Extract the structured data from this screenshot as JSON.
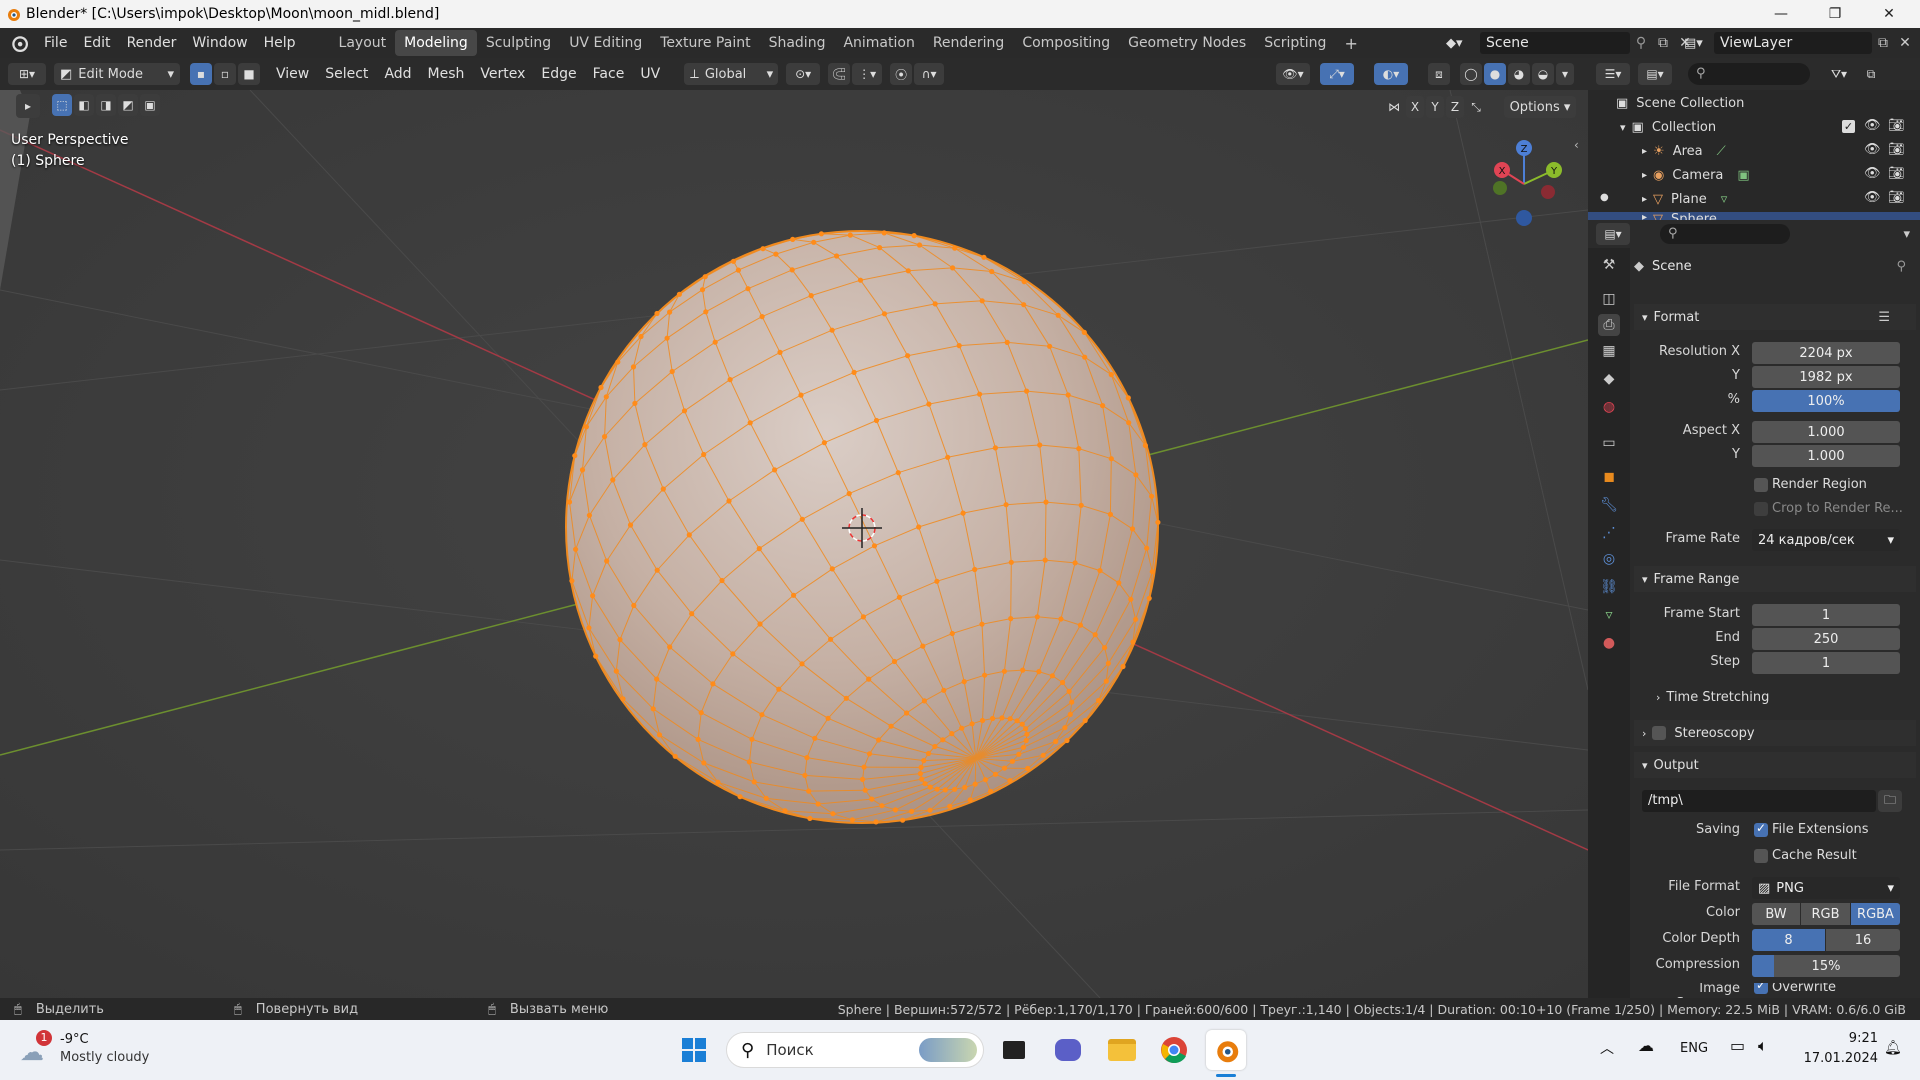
{
  "window": {
    "title": "Blender* [C:\\Users\\impok\\Desktop\\Moon\\moon_midl.blend]"
  },
  "menu": [
    "File",
    "Edit",
    "Render",
    "Window",
    "Help"
  ],
  "workspaces": [
    "Layout",
    "Modeling",
    "Sculpting",
    "UV Editing",
    "Texture Paint",
    "Shading",
    "Animation",
    "Rendering",
    "Compositing",
    "Geometry Nodes",
    "Scripting"
  ],
  "active_workspace": "Modeling",
  "scene_name": "Scene",
  "view_layer": "ViewLayer",
  "viewport_header": {
    "mode": "Edit Mode",
    "menus": [
      "View",
      "Select",
      "Add",
      "Mesh",
      "Vertex",
      "Edge",
      "Face",
      "UV"
    ],
    "transform": "Global",
    "options": "Options",
    "axes": [
      "X",
      "Y",
      "Z"
    ]
  },
  "viewport": {
    "perspective": "User Perspective",
    "object": "(1) Sphere",
    "gizmo": [
      "X",
      "Y",
      "Z"
    ]
  },
  "outliner": {
    "root": "Scene Collection",
    "collection": "Collection",
    "items": [
      "Area",
      "Camera",
      "Plane",
      "Sphere"
    ]
  },
  "properties": {
    "context": "Scene",
    "format": {
      "title": "Format",
      "res_x_label": "Resolution X",
      "res_x": "2204 px",
      "res_y_label": "Y",
      "res_y": "1982 px",
      "pct_label": "%",
      "pct": "100%",
      "aspect_x_label": "Aspect X",
      "aspect_x": "1.000",
      "aspect_y_label": "Y",
      "aspect_y": "1.000",
      "render_region": "Render Region",
      "crop": "Crop to Render Re...",
      "frame_rate_label": "Frame Rate",
      "frame_rate": "24 кадров/сек"
    },
    "frame_range": {
      "title": "Frame Range",
      "start_label": "Frame Start",
      "start": "1",
      "end_label": "End",
      "end": "250",
      "step_label": "Step",
      "step": "1",
      "time_stretching": "Time Stretching"
    },
    "stereoscopy": "Stereoscopy",
    "output": {
      "title": "Output",
      "path": "/tmp\\",
      "saving_label": "Saving",
      "file_extensions": "File Extensions",
      "cache_result": "Cache Result",
      "file_format_label": "File Format",
      "file_format": "PNG",
      "color_label": "Color",
      "color_options": [
        "BW",
        "RGB",
        "RGBA"
      ],
      "color_selected": "RGBA",
      "depth_label": "Color Depth",
      "depth_options": [
        "8",
        "16"
      ],
      "depth_selected": "8",
      "compression_label": "Compression",
      "compression": "15%",
      "compression_value": 0.15,
      "image_sequence_label": "Image Sequence",
      "overwrite": "Overwrite"
    }
  },
  "statusbar": {
    "select": "Выделить",
    "rotate": "Повернуть вид",
    "menu": "Вызвать меню",
    "stats": "Sphere | Вершин:572/572 | Рёбер:1,170/1,170 | Граней:600/600 | Треуг.:1,140 | Objects:1/4 | Duration: 00:10+10 (Frame 1/250) | Memory: 22.5 MiB | VRAM: 0.6/6.0 GiB"
  },
  "taskbar": {
    "weather_temp": "-9°C",
    "weather_desc": "Mostly cloudy",
    "weather_badge": "1",
    "search": "Поиск",
    "lang": "ENG",
    "time": "9:21",
    "date": "17.01.2024"
  },
  "colors": {
    "accent": "#4772b3",
    "selection": "#ff8c1a",
    "mesh": "#c8b4a8"
  }
}
